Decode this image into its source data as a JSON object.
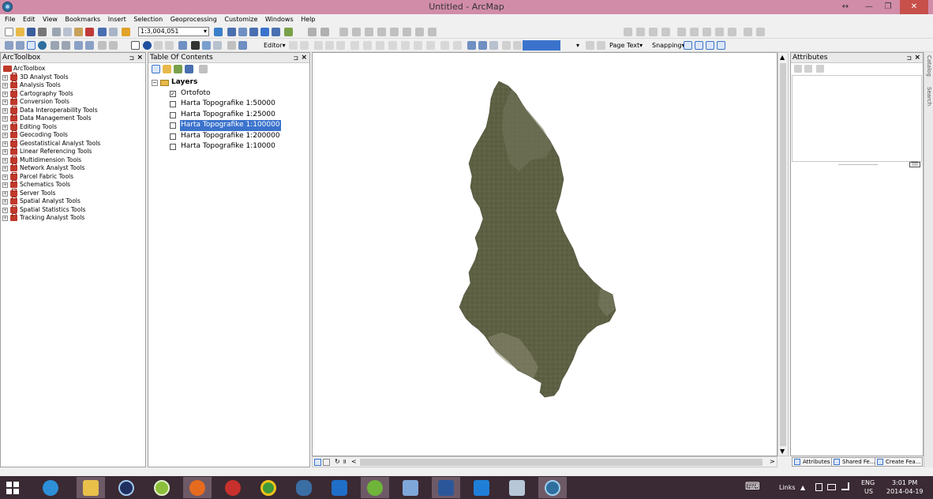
{
  "window": {
    "title": "Untitled - ArcMap",
    "restore_glyph": "↔",
    "minimize_glyph": "—",
    "maximize_glyph": "❐",
    "close_glyph": "✕"
  },
  "menu": [
    "File",
    "Edit",
    "View",
    "Bookmarks",
    "Insert",
    "Selection",
    "Geoprocessing",
    "Customize",
    "Windows",
    "Help"
  ],
  "toolbar": {
    "scale": "1:3,004,051",
    "editor_label": "Editor▾",
    "page_text_label": "Page Text▾",
    "snapping_label": "Snapping▾"
  },
  "arctoolbox": {
    "title": "ArcToolbox",
    "pin": "⊐",
    "close": "×",
    "root": "ArcToolbox",
    "items": [
      "3D Analyst Tools",
      "Analysis Tools",
      "Cartography Tools",
      "Conversion Tools",
      "Data Interoperability Tools",
      "Data Management Tools",
      "Editing Tools",
      "Geocoding Tools",
      "Geostatistical Analyst Tools",
      "Linear Referencing Tools",
      "Multidimension Tools",
      "Network Analyst Tools",
      "Parcel Fabric Tools",
      "Schematics Tools",
      "Server Tools",
      "Spatial Analyst Tools",
      "Spatial Statistics Tools",
      "Tracking Analyst Tools"
    ],
    "expander": "+"
  },
  "toc": {
    "title": "Table Of Contents",
    "pin": "⊐",
    "close": "×",
    "group_label": "Layers",
    "group_expander": "−",
    "layers": [
      {
        "name": "Ortofoto",
        "checked": true,
        "mark": "✓"
      },
      {
        "name": "Harta Topografike 1:50000",
        "checked": false,
        "mark": ""
      },
      {
        "name": "Harta Topografike 1:25000",
        "checked": false,
        "mark": ""
      },
      {
        "name": "Harta Topografike 1:100000",
        "checked": false,
        "mark": "",
        "selected": true
      },
      {
        "name": "Harta Topografike 1:200000",
        "checked": false,
        "mark": ""
      },
      {
        "name": "Harta Topografike 1:10000",
        "checked": false,
        "mark": ""
      }
    ]
  },
  "attributes": {
    "title": "Attributes",
    "pin": "⊐",
    "close": "×",
    "size_indicator": "░░",
    "tabs": [
      "Attributes",
      "Shared Fe...",
      "Create Fea..."
    ]
  },
  "side_tabs": [
    "Catalog",
    "Search"
  ],
  "scroll": {
    "up": "▲",
    "down": "▼",
    "left": "<",
    "right": ">",
    "pause": "॥",
    "refresh": "↻"
  },
  "taskbar": {
    "keyboard_glyph": "⌨",
    "links_label": "Links",
    "tray_arrow": "▲",
    "lang_top": "ENG",
    "lang_bottom": "US",
    "time": "3:01 PM",
    "date": "2014-04-19"
  },
  "colors": {
    "titlebar": "#d18ca8",
    "selection": "#3b73cc",
    "map_fill": "#5e6044",
    "taskbar": "#3a2a33"
  }
}
